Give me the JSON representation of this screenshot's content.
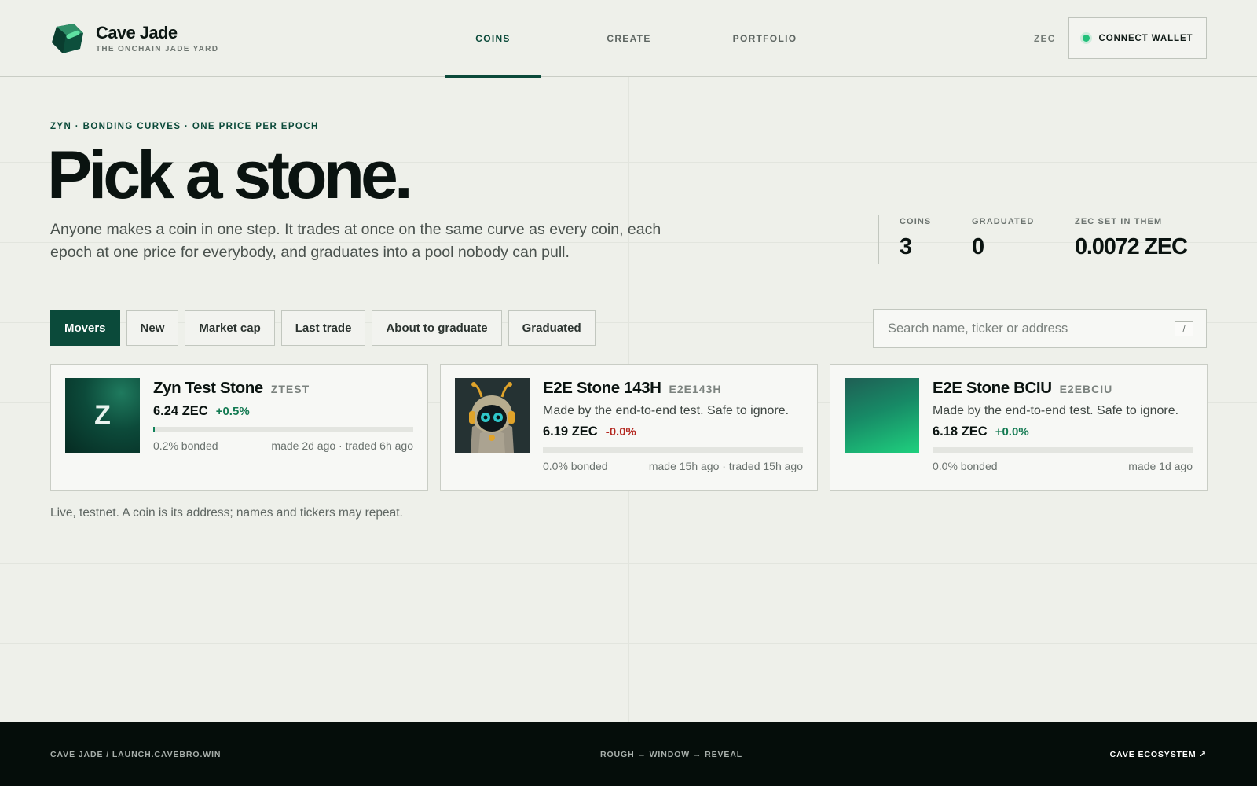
{
  "header": {
    "brand_name": "Cave Jade",
    "brand_sub": "THE ONCHAIN JADE YARD",
    "nav": [
      {
        "label": "COINS",
        "active": true
      },
      {
        "label": "CREATE",
        "active": false
      },
      {
        "label": "PORTFOLIO",
        "active": false
      }
    ],
    "currency": "ZEC",
    "wallet_button": "CONNECT WALLET"
  },
  "hero": {
    "eyebrow": "ZYN · BONDING CURVES · ONE PRICE PER EPOCH",
    "title": "Pick a stone.",
    "description": "Anyone makes a coin in one step. It trades at once on the same curve as every coin, each epoch at one price for everybody, and graduates into a pool nobody can pull."
  },
  "stats": [
    {
      "label": "COINS",
      "value": "3"
    },
    {
      "label": "GRADUATED",
      "value": "0"
    },
    {
      "label": "ZEC SET IN THEM",
      "value": "0.0072 ZEC"
    }
  ],
  "filters": [
    {
      "label": "Movers",
      "active": true
    },
    {
      "label": "New",
      "active": false
    },
    {
      "label": "Market cap",
      "active": false
    },
    {
      "label": "Last trade",
      "active": false
    },
    {
      "label": "About to graduate",
      "active": false
    },
    {
      "label": "Graduated",
      "active": false
    }
  ],
  "search": {
    "placeholder": "Search name, ticker or address",
    "value": "",
    "shortcut": "/"
  },
  "coins": [
    {
      "name": "Zyn Test Stone",
      "ticker": "ZTEST",
      "thumb_letter": "Z",
      "description": "",
      "price": "6.24 ZEC",
      "change": "+0.5%",
      "change_direction": "up",
      "bonded_fraction": 0.002,
      "bonded_label": "0.2% bonded",
      "times": "made 2d ago · traded 6h ago"
    },
    {
      "name": "E2E Stone 143H",
      "ticker": "E2E143H",
      "thumb_letter": "",
      "description": "Made by the end-to-end test. Safe to ignore.",
      "price": "6.19 ZEC",
      "change": "-0.0%",
      "change_direction": "down",
      "bonded_fraction": 0.0,
      "bonded_label": "0.0% bonded",
      "times": "made 15h ago · traded 15h ago"
    },
    {
      "name": "E2E Stone BCIU",
      "ticker": "E2EBCIU",
      "thumb_letter": "",
      "description": "Made by the end-to-end test. Safe to ignore.",
      "price": "6.18 ZEC",
      "change": "+0.0%",
      "change_direction": "up",
      "bonded_fraction": 0.0,
      "bonded_label": "0.0% bonded",
      "times": "made 1d ago"
    }
  ],
  "footnote": "Live, testnet. A coin is its address; names and tickers may repeat.",
  "footer": {
    "left": "CAVE JADE / LAUNCH.CAVEBRO.WIN",
    "middle": "ROUGH → WINDOW → REVEAL",
    "right": "CAVE ECOSYSTEM ↗"
  },
  "colors": {
    "accent": "#0b4a3a",
    "background": "#eef0ea",
    "positive": "#137a52",
    "negative": "#b3261e",
    "footer": "#050d0a"
  }
}
